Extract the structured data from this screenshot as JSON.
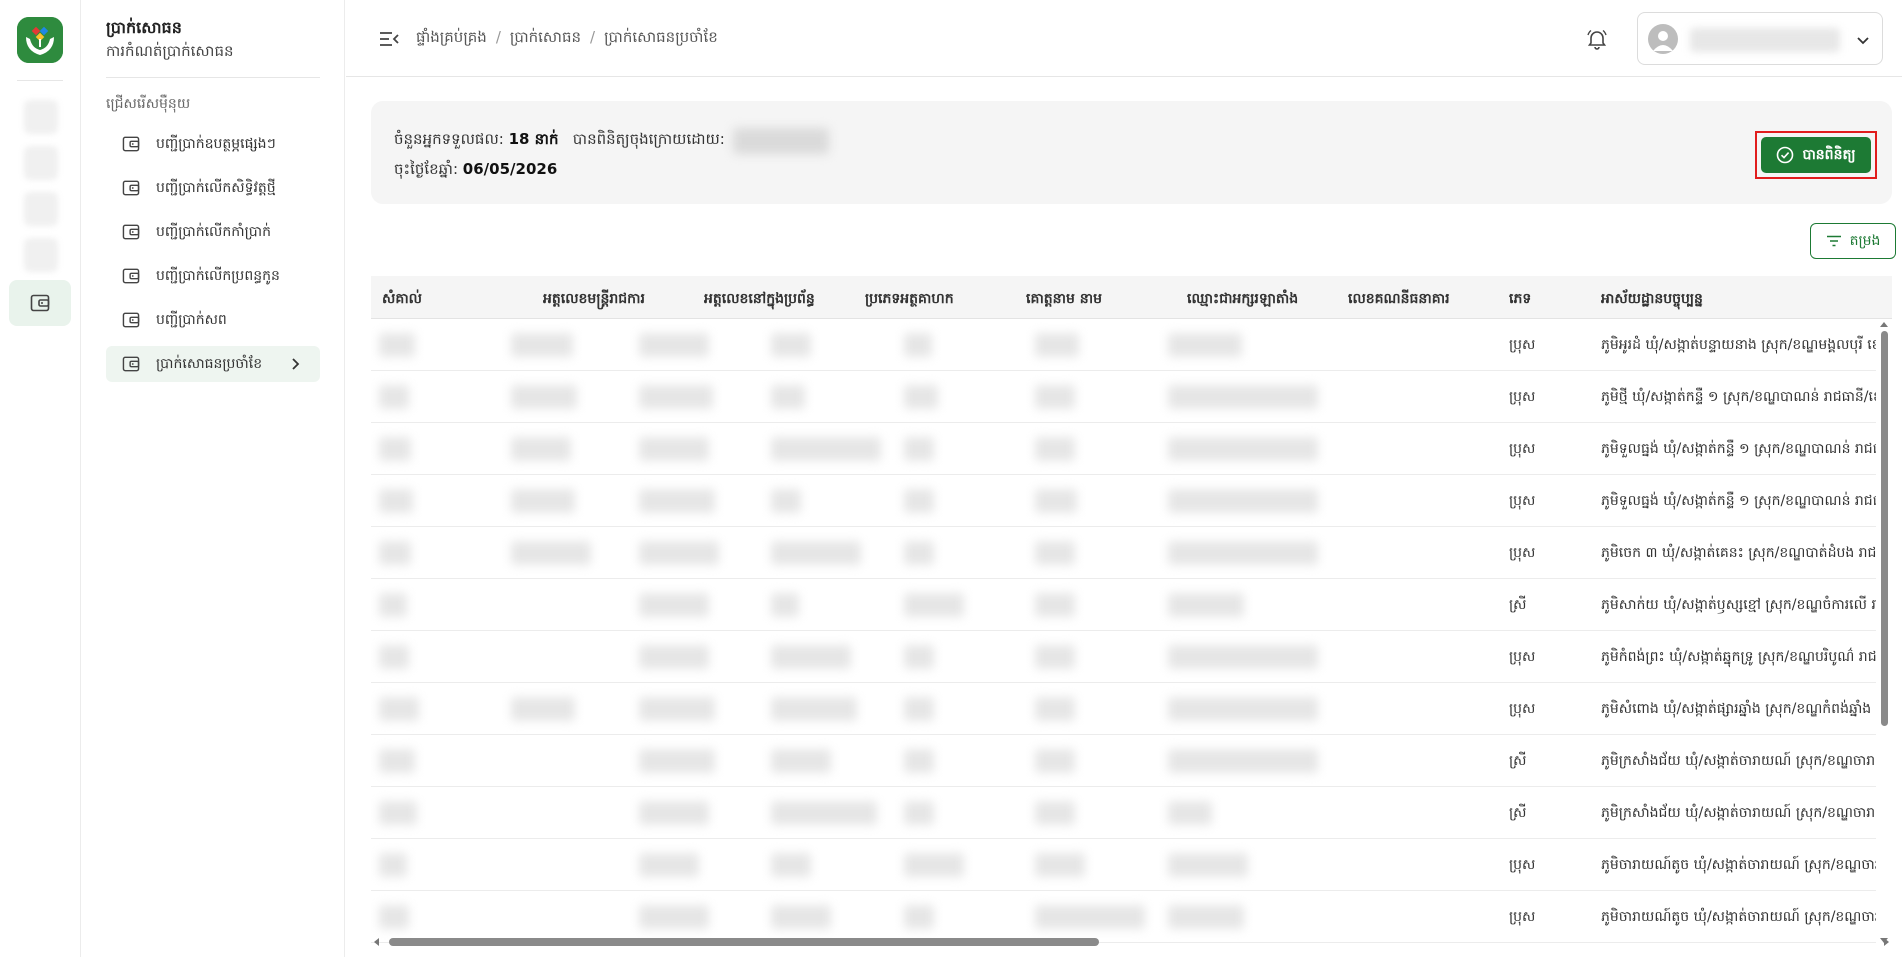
{
  "sidebar": {
    "title": "ប្រាក់សោធន",
    "subtitle": "ការកំណត់ប្រាក់សោធន",
    "section_label": "ជ្រើសរើសម៉ឺនុយ",
    "items": [
      {
        "label": "បញ្ជីប្រាក់ឧបត្ថម្ភផ្សេងៗ"
      },
      {
        "label": "បញ្ជីប្រាក់លើកសិទ្ធិវត្តថ្មី"
      },
      {
        "label": "បញ្ជីប្រាក់លើកកាំប្រាក់"
      },
      {
        "label": "បញ្ជីប្រាក់លើកប្រពន្ធកូន"
      },
      {
        "label": "បញ្ជីប្រាក់សព"
      },
      {
        "label": "ប្រាក់សោធនប្រចាំខែ"
      }
    ]
  },
  "breadcrumb": [
    "ផ្ទាំងគ្រប់គ្រង",
    "ប្រាក់សោធន",
    "ប្រាក់សោធនប្រចាំខែ"
  ],
  "breadcrumb_sep": "/",
  "info": {
    "recipients_label": "ចំនួនអ្នកទទួលផល:",
    "recipients_value": "18 នាក់",
    "reviewed_by_label": "បានពិនិត្យចុងក្រោយដោយ:",
    "date_label": "ចុះថ្ងៃខែឆ្នាំ:",
    "date_value": "06/05/2026"
  },
  "verify_button": "បានពិនិត្យ",
  "filter_button": "តម្រង",
  "table": {
    "columns": [
      "សំគាល់",
      "អត្តលេខមន្ត្រីរាជការ",
      "អត្តលេខនៅក្នុងប្រព័ន្ធ",
      "ប្រភេទអត្ថគាហក",
      "គោត្តនាម នាម",
      "ឈ្មោះជាអក្សរឡាតាំង",
      "លេខគណនីធនាគារ",
      "ភេទ",
      "អាស័យដ្ឋានបច្ចុប្បន្ន"
    ],
    "rows": [
      {
        "gender": "ប្រុស",
        "address": "ភូមិអូរដំ ឃុំ/សង្កាត់បន្ទាយនាង ស្រុក/ខណ្ឌមង្គលបុរី ខេ"
      },
      {
        "gender": "ប្រុស",
        "address": "ភូមិថ្មី ឃុំ/សង្កាត់កន្ទឺ ១ ស្រុក/ខណ្ឌបាណន់ រាជធានី/ខេ"
      },
      {
        "gender": "ប្រុស",
        "address": "ភូមិទួលធ្នង់ ឃុំ/សង្កាត់កន្ទឺ ១ ស្រុក/ខណ្ឌបាណន់ រាជធា"
      },
      {
        "gender": "ប្រុស",
        "address": "ភូមិទួលធ្នង់ ឃុំ/សង្កាត់កន្ទឺ ១ ស្រុក/ខណ្ឌបាណន់ រាជធា"
      },
      {
        "gender": "ប្រុស",
        "address": "ភូមិចេក ៣ ឃុំ/សង្កាត់គេនះ ស្រុក/ខណ្ឌបាត់ដំបង រាជធ"
      },
      {
        "gender": "ស្រី",
        "address": "ភូមិសាក់យ ឃុំ/សង្កាត់ឫស្សខ្មៅ ស្រុក/ខណ្ឌចំការលើ រាជ"
      },
      {
        "gender": "ប្រុស",
        "address": "ភូមិកំពង់ព្រះ ឃុំ/សង្កាត់ឆ្នុកទ្រូ ស្រុក/ខណ្ឌបរិបូណ៌ រាជធ"
      },
      {
        "gender": "ប្រុស",
        "address": "ភូមិសំពោង ឃុំ/សង្កាត់ផ្សារឆ្នាំង ស្រុក/ខណ្ឌកំពង់ឆ្នាំង រា"
      },
      {
        "gender": "ស្រី",
        "address": "ភូមិក្រសាំងជ័យ ឃុំ/សង្កាត់ចារាយណ៍ ស្រុក/ខណ្ឌចារា"
      },
      {
        "gender": "ស្រី",
        "address": "ភូមិក្រសាំងជ័យ ឃុំ/សង្កាត់ចារាយណ៍ ស្រុក/ខណ្ឌចារា"
      },
      {
        "gender": "ប្រុស",
        "address": "ភូមិចារាយណ៍តូច ឃុំ/សង្កាត់ចារាយណ៍ ស្រុក/ខណ្ឌចារ"
      },
      {
        "gender": "ប្រុស",
        "address": "ភូមិចារាយណ៍តូច ឃុំ/សង្កាត់ចារាយណ៍ ស្រុក/ខណ្ឌចារ"
      }
    ]
  },
  "colors": {
    "primary": "#1d7a34",
    "highlight_border": "#e11d1d",
    "active_bg": "#eef5f0"
  },
  "icons": {
    "logo": "hands-heart-logo",
    "menu": "menu-collapse-icon",
    "bell": "bell-icon",
    "wallet": "wallet-icon",
    "filter": "filter-icon",
    "check": "check-circle-icon"
  }
}
